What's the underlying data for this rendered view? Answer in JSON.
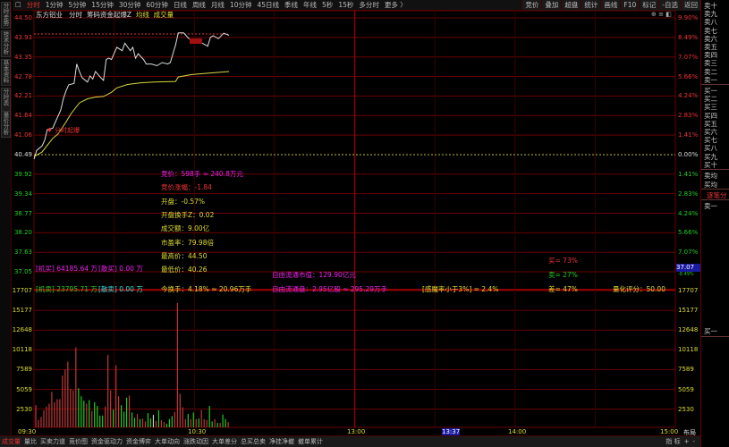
{
  "toolbar": {
    "tabs": [
      "分时",
      "1分钟",
      "5分钟",
      "15分钟",
      "30分钟",
      "60分钟",
      "日线",
      "周线",
      "月线",
      "10分钟",
      "45日线",
      "季线",
      "年线",
      "5秒",
      "15秒",
      "多分时",
      "更多 〉"
    ],
    "right": [
      "竞价",
      "叠加",
      "超盘",
      "统计",
      "画线",
      "F10",
      "标记",
      "-自选",
      "返回"
    ]
  },
  "left_tabs": [
    "分时走势",
    "技术分析",
    "基本资料",
    "分时表",
    "量价分析"
  ],
  "header": {
    "stock": "东方铝业",
    "mode": "分时",
    "indicator": "筹码资金起爆Z",
    "avg_label": "均线",
    "vol_label": "成交量",
    "icons": [
      "plus-circle-icon",
      "menu-icon",
      "layout-icon"
    ]
  },
  "price_axis": {
    "left": [
      "44.50",
      "43.93",
      "43.35",
      "42.78",
      "42.21",
      "41.64",
      "41.06",
      "40.49",
      "39.92",
      "39.34",
      "38.77",
      "38.20",
      "37.63",
      "37.05"
    ],
    "right": [
      "9.90%",
      "8.49%",
      "7.07%",
      "5.66%",
      "4.24%",
      "2.83%",
      "1.41%",
      "0.00%",
      "1.41%",
      "2.83%",
      "4.24%",
      "5.66%",
      "7.07%",
      "-8.49%"
    ],
    "cursor_price": "37.07"
  },
  "volume_axis": [
    "17707",
    "15177",
    "12648",
    "10118",
    "7589",
    "5059",
    "2530"
  ],
  "time_axis": {
    "labels": [
      "09:30",
      "10:30",
      "13:00",
      "14:00",
      "15:00"
    ],
    "cursor_time": "13:37",
    "layout_button": "布局"
  },
  "markers": {
    "breakout": "分时起爆"
  },
  "info": {
    "auction": "竞价：598手 ≈ 240.8万元",
    "auction_change": "竞价涨幅：-1.84",
    "open": "开盘：-0.57%",
    "open_turnover": "开盘换手Z：0.02",
    "amount": "成交额：9.00亿",
    "pe": "市盈率：79.98倍",
    "high": "最高价：44.50",
    "low": "最低价：40.26",
    "turnover": "今换手：4.18% ≈ 20.96万手",
    "free_mcap": "自由流通市值：129.90亿元",
    "free_shares": "自由流通盘：2.95亿股 ≈ 295.29万手",
    "inst_buy": "[机买] 64185.64 万",
    "retail_buy": "[散买] 0.00 万",
    "inst_sell": "[机卖] 23795.71 万",
    "retail_sell": "[散卖] 0.00 万",
    "buy_pct": "买= 73%",
    "sell_pct": "卖= 27%",
    "diff_pct": "差= 47%",
    "ratio": "[感魔率小于3%] = 2.4%",
    "score": "量化评分：50.00"
  },
  "order_book": {
    "asks": [
      "卖十",
      "卖九",
      "卖八",
      "卖七",
      "卖六",
      "卖五",
      "卖四",
      "卖三",
      "卖二",
      "卖一"
    ],
    "bids": [
      "买一",
      "买二",
      "买三",
      "买四",
      "买五",
      "买六",
      "买七",
      "买八",
      "买九",
      "买十"
    ],
    "avg_sell": "卖均",
    "avg_buy": "买均",
    "tick_tab": "逐笔分",
    "tick_sell1": "卖一",
    "tick_buy1": "买一"
  },
  "bottom_tabs": [
    "成交量",
    "量比",
    "买卖力道",
    "竞价图",
    "资金驱动力",
    "资金博弈",
    "大单动向",
    "涨跌动因",
    "大单差分",
    "总买总卖",
    "净挂净撤",
    "撤单累计"
  ],
  "bottom_right": [
    "指 标",
    "+",
    "-"
  ],
  "colors": {
    "up": "#e33333",
    "down": "#22cc22",
    "price_line": "#dddddd",
    "avg_line": "#d8d840",
    "grid": "#6a0000"
  },
  "chart_data": {
    "type": "line",
    "prev_close": 40.49,
    "ylim": [
      37.05,
      44.5
    ],
    "price": [
      [
        0,
        40.36
      ],
      [
        1,
        40.62
      ],
      [
        3,
        40.75
      ],
      [
        4,
        40.92
      ],
      [
        5,
        41.23
      ],
      [
        7,
        41.27
      ],
      [
        8,
        41.45
      ],
      [
        10,
        41.8
      ],
      [
        11,
        42.14
      ],
      [
        12,
        42.36
      ],
      [
        13,
        42.54
      ],
      [
        15,
        42.58
      ],
      [
        16,
        43.15
      ],
      [
        17,
        42.93
      ],
      [
        18,
        42.75
      ],
      [
        20,
        42.62
      ],
      [
        21,
        42.8
      ],
      [
        22,
        42.71
      ],
      [
        23,
        42.93
      ],
      [
        25,
        42.75
      ],
      [
        26,
        42.67
      ],
      [
        27,
        43.28
      ],
      [
        28,
        43.32
      ],
      [
        29,
        43.28
      ],
      [
        31,
        43.64
      ],
      [
        33,
        43.54
      ],
      [
        34,
        43.76
      ],
      [
        36,
        43.54
      ],
      [
        37,
        43.64
      ],
      [
        38,
        43.32
      ],
      [
        39,
        43.45
      ],
      [
        41,
        43.28
      ],
      [
        42,
        43.15
      ],
      [
        44,
        43.15
      ],
      [
        46,
        43.1
      ],
      [
        48,
        43.19
      ],
      [
        50,
        43.15
      ],
      [
        51,
        43.19
      ],
      [
        52,
        43.45
      ],
      [
        53,
        43.71
      ],
      [
        54,
        44.06
      ],
      [
        56,
        44.06
      ],
      [
        58,
        43.89
      ],
      [
        60,
        43.85
      ],
      [
        61,
        43.8
      ],
      [
        63,
        43.76
      ],
      [
        65,
        43.67
      ],
      [
        66,
        43.93
      ],
      [
        67,
        43.98
      ],
      [
        69,
        43.89
      ],
      [
        71,
        44.05
      ],
      [
        73,
        43.99
      ]
    ],
    "avg": [
      [
        0,
        40.44
      ],
      [
        3,
        40.57
      ],
      [
        7,
        40.97
      ],
      [
        9,
        41.1
      ],
      [
        12,
        41.45
      ],
      [
        14,
        41.71
      ],
      [
        17,
        42.01
      ],
      [
        20,
        42.13
      ],
      [
        23,
        42.18
      ],
      [
        26,
        42.2
      ],
      [
        29,
        42.32
      ],
      [
        31,
        42.45
      ],
      [
        35,
        42.55
      ],
      [
        40,
        42.6
      ],
      [
        45,
        42.62
      ],
      [
        53,
        42.64
      ],
      [
        54,
        42.77
      ],
      [
        59,
        42.84
      ],
      [
        65,
        42.88
      ],
      [
        73,
        42.93
      ]
    ],
    "volume": [
      2875,
      955,
      1345,
      2185,
      2680,
      3070,
      4600,
      3255,
      3645,
      3645,
      6705,
      7475,
      8510,
      4980,
      4795,
      10350,
      5060,
      4025,
      3450,
      3070,
      3530,
      2105,
      3255,
      2760,
      1530,
      1530,
      2680,
      9395,
      4795,
      2300,
      8050,
      4025,
      2875,
      2030,
      3830,
      4105,
      1920,
      1230,
      1725,
      1070,
      1150,
      765,
      1840,
      1150,
      1610,
      840,
      2220,
      955,
      690,
      460,
      1070,
      1460,
      1995,
      16100,
      4335,
      2605,
      1070,
      1725,
      1070,
      1920,
      1070,
      1150,
      2220,
      1070,
      955,
      2760,
      765,
      1070,
      575,
      575,
      1645,
      1070,
      690
    ],
    "volume_colors": "rrrrrrrrrrrrrrrrgggrgrggggrrrgrrgggrggrgrrggwrgrrgggrrrrrgrgrgrrrggrgrggrwg",
    "volume_ylim": [
      0,
      17707
    ]
  }
}
